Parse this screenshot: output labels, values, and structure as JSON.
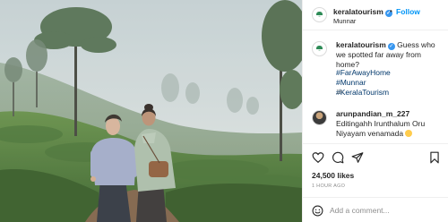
{
  "header": {
    "username": "keralatourism",
    "location": "Munnar",
    "follow_label": "Follow",
    "separator": "•"
  },
  "caption": {
    "username": "keralatourism",
    "text": "Guess who we spotted far away from home?",
    "hashtags": [
      "#FarAwayHome",
      "#Munnar",
      "#KeralaTourism"
    ],
    "time_ago": "1h"
  },
  "comments": [
    {
      "username": "arunpandian_m_227",
      "text": "Editingahh Irunthalum Oru Niyayam venamada",
      "emoji": "smiling-face"
    }
  ],
  "actions": {
    "icons": [
      "heart-icon",
      "comment-icon",
      "share-icon",
      "bookmark-icon"
    ],
    "likes": "24,500 likes",
    "timestamp": "1 HOUR AGO"
  },
  "add_comment": {
    "placeholder": "Add a comment..."
  },
  "colors": {
    "link_blue": "#0095f6",
    "hashtag": "#00376b",
    "verified": "#3897f0",
    "secondary_text": "#8e8e8e"
  }
}
